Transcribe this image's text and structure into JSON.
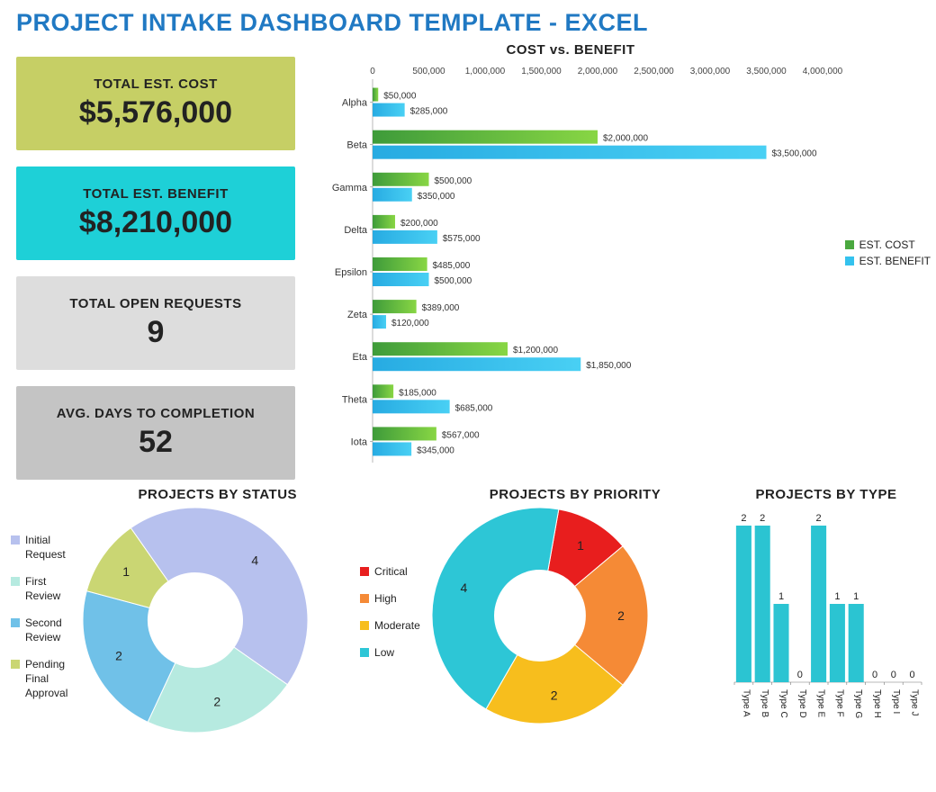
{
  "title": "PROJECT INTAKE DASHBOARD TEMPLATE - EXCEL",
  "cards": {
    "cost": {
      "label": "TOTAL EST. COST",
      "value": "$5,576,000"
    },
    "benefit": {
      "label": "TOTAL EST. BENEFIT",
      "value": "$8,210,000"
    },
    "open": {
      "label": "TOTAL OPEN REQUESTS",
      "value": "9"
    },
    "days": {
      "label": "AVG. DAYS TO COMPLETION",
      "value": "52"
    }
  },
  "chart_data": [
    {
      "id": "cost_vs_benefit",
      "type": "bar",
      "orientation": "horizontal",
      "title": "COST vs. BENEFIT",
      "xlim": [
        0,
        4000000
      ],
      "xticks": [
        0,
        500000,
        1000000,
        1500000,
        2000000,
        2500000,
        3000000,
        3500000,
        4000000
      ],
      "xtick_labels": [
        "0",
        "500,000",
        "1,000,000",
        "1,500,000",
        "2,000,000",
        "2,500,000",
        "3,000,000",
        "3,500,000",
        "4,000,000"
      ],
      "categories": [
        "Alpha",
        "Beta",
        "Gamma",
        "Delta",
        "Epsilon",
        "Zeta",
        "Eta",
        "Theta",
        "Iota"
      ],
      "series": [
        {
          "name": "EST. COST",
          "color_from": "#3e9b3a",
          "color_to": "#88d644",
          "values": [
            50000,
            2000000,
            500000,
            200000,
            485000,
            389000,
            1200000,
            185000,
            567000
          ],
          "labels": [
            "$50,000",
            "$2,000,000",
            "$500,000",
            "$200,000",
            "$485,000",
            "$389,000",
            "$1,200,000",
            "$185,000",
            "$567,000"
          ]
        },
        {
          "name": "EST. BENEFIT",
          "color_from": "#27abe2",
          "color_to": "#49d0f4",
          "values": [
            285000,
            3500000,
            350000,
            575000,
            500000,
            120000,
            1850000,
            685000,
            345000
          ],
          "labels": [
            "$285,000",
            "$3,500,000",
            "$350,000",
            "$575,000",
            "$500,000",
            "$120,000",
            "$1,850,000",
            "$685,000",
            "$345,000"
          ]
        }
      ]
    },
    {
      "id": "projects_by_status",
      "type": "pie",
      "donut": true,
      "title": "PROJECTS BY STATUS",
      "slices": [
        {
          "label": "Initial Request",
          "value": 4,
          "color": "#b7c1ee"
        },
        {
          "label": "First Review",
          "value": 2,
          "color": "#b6eae0"
        },
        {
          "label": "Second Review",
          "value": 2,
          "color": "#70c1e8"
        },
        {
          "label": "Pending Final Approval",
          "value": 1,
          "color": "#cad673"
        }
      ]
    },
    {
      "id": "projects_by_priority",
      "type": "pie",
      "donut": true,
      "title": "PROJECTS BY PRIORITY",
      "slices": [
        {
          "label": "Critical",
          "value": 1,
          "color": "#e81e1e"
        },
        {
          "label": "High",
          "value": 2,
          "color": "#f58a36"
        },
        {
          "label": "Moderate",
          "value": 2,
          "color": "#f7be1d"
        },
        {
          "label": "Low",
          "value": 4,
          "color": "#2dc6d6"
        }
      ]
    },
    {
      "id": "projects_by_type",
      "type": "bar",
      "title": "PROJECTS BY TYPE",
      "ylim": [
        0,
        2
      ],
      "categories": [
        "Type A",
        "Type B",
        "Type C",
        "Type D",
        "Type E",
        "Type F",
        "Type G",
        "Type H",
        "Type I",
        "Type J"
      ],
      "values": [
        2,
        2,
        1,
        0,
        2,
        1,
        1,
        0,
        0,
        0
      ],
      "color": "#2bc4d2"
    }
  ]
}
